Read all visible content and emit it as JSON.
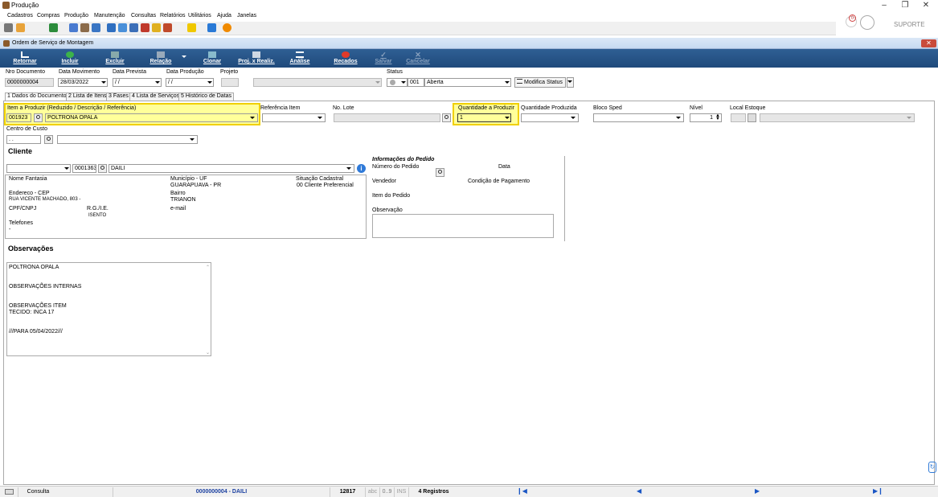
{
  "app": {
    "title": "Produção"
  },
  "menu": [
    "Cadastros",
    "Compras",
    "Produção",
    "Manutenção",
    "Consultas",
    "Relatórios",
    "Utilitários",
    "Ajuda",
    "Janelas"
  ],
  "user": {
    "name": "SUPORTE",
    "notifications": "0"
  },
  "child": {
    "title": "Ordem de Serviço de Montagem"
  },
  "toolbar": {
    "retornar": "Retornar",
    "incluir": "Incluir",
    "excluir": "Excluir",
    "relacao": "Relação",
    "clonar": "Clonar",
    "proj": "Proj. x Realiz.",
    "analise": "Análise",
    "recados": "Recados",
    "salvar": "Salvar",
    "cancelar": "Cancelar"
  },
  "header": {
    "nro_label": "Nro Documento",
    "nro_value": "0000000004",
    "data_mov_label": "Data Movimento",
    "data_mov_value": "28/03/2022",
    "data_prev_label": "Data Prevista",
    "data_prev_value": " / /",
    "data_prod_label": "Data Produção",
    "data_prod_value": " / /",
    "projeto_label": "Projeto",
    "status_label": "Status",
    "status_code": "001",
    "status_value": "Aberta",
    "modifica_status": "Modifica Status"
  },
  "tabs": [
    "1 Dados do Documento",
    "2 Lista de Itens",
    "3 Fases",
    "4 Lista de Serviços",
    "5 Histórico de Datas"
  ],
  "item": {
    "label": "Item a Produzir (Reduzido / Descrição / Referência)",
    "code": "001923",
    "desc": "POLTRONA OPALA",
    "ref_label": "Referência Item",
    "lote_label": "No. Lote",
    "qtd_label": "Quantidade a Produzir",
    "qtd_value": "1",
    "qtd_prod_label": "Quantidade Produzida",
    "bloco_label": "Bloco Sped",
    "nivel_label": "Nível",
    "nivel_value": "1",
    "local_label": "Local Estoque",
    "centro_label": "Centro de Custo",
    "centro_value": " . ."
  },
  "cliente": {
    "title": "Cliente",
    "code": "0001363",
    "name": "DAILI",
    "nome_fantasia_label": "Nome Fantasia",
    "municipio_label": "Município - UF",
    "municipio_value": "GUARAPUAVA - PR",
    "situacao_label": "Situação Cadastral",
    "situacao_value": "00 Cliente Preferencial",
    "endereco_label": "Endereco - CEP",
    "endereco_value": "RUA VICENTE MACHADO, 803 -",
    "bairro_label": "Bairro",
    "bairro_value": "TRIANON",
    "cpf_label": "CPF/CNPJ",
    "rg_label": "R.G./I.E.",
    "rg_value": "ISENTO",
    "email_label": "e-mail",
    "telefones_label": "Telefones",
    "telefones_value": "-"
  },
  "pedido": {
    "title": "Informações do Pedido",
    "numero_label": "Número do Pedido",
    "data_label": "Data",
    "vendedor_label": "Vendedor",
    "condicao_label": "Condição de Pagamento",
    "item_label": "Item do Pedido",
    "obs_label": "Observação"
  },
  "observacoes": {
    "title": "Observações",
    "lines": [
      "POLTRONA OPALA",
      "",
      "",
      "OBSERVAÇÕES INTERNAS",
      "",
      "",
      "OBSERVAÇÕES ITEM",
      "TECIDO: INCA 17",
      "",
      "",
      "///PARA 05/04/2022///"
    ]
  },
  "status": {
    "mode": "Consulta",
    "doc": "0000000004 - DAILI",
    "num": "12817",
    "abc": "abc",
    "digits": "0..9",
    "ins": "INS",
    "registros": "4 Registros"
  },
  "colors": {
    "toolbar_blue": "#1f4a7b",
    "highlight": "#ffff9a",
    "link": "#1a56c4"
  }
}
